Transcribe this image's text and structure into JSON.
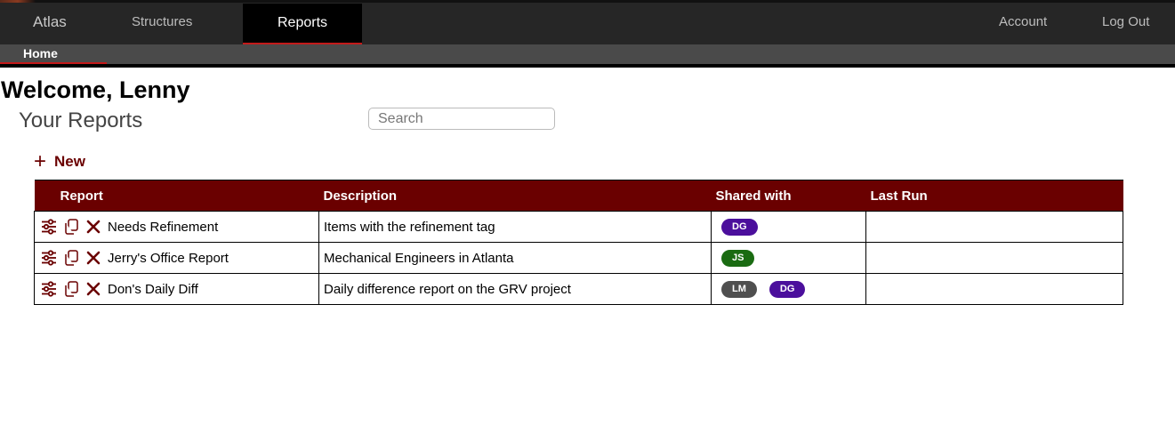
{
  "nav": {
    "brand": "Atlas",
    "structures": "Structures",
    "reports": "Reports",
    "account": "Account",
    "logout": "Log Out"
  },
  "subnav": {
    "home": "Home"
  },
  "page": {
    "welcome": "Welcome, Lenny",
    "section_title": "Your Reports",
    "search_placeholder": "Search",
    "new_label": "New"
  },
  "table": {
    "headers": [
      "Report",
      "Description",
      "Shared with",
      "Last Run"
    ],
    "rows": [
      {
        "name": "Needs Refinement",
        "description": "Items with the refinement tag",
        "shared": [
          {
            "initials": "DG",
            "color": "#4b0f9c"
          }
        ],
        "last_run": ""
      },
      {
        "name": "Jerry's Office Report",
        "description": "Mechanical Engineers in Atlanta",
        "shared": [
          {
            "initials": "JS",
            "color": "#1a6b12"
          }
        ],
        "last_run": ""
      },
      {
        "name": "Don's Daily Diff",
        "description": "Daily difference report on the GRV project",
        "shared": [
          {
            "initials": "LM",
            "color": "#4f4f4f"
          },
          {
            "initials": "DG",
            "color": "#4b0f9c"
          }
        ],
        "last_run": ""
      }
    ]
  },
  "colors": {
    "accent": "#6a0000",
    "nav_bg": "#262626",
    "active_underline": "#c41a1a"
  },
  "icons": {
    "settings": "sliders-icon",
    "copy": "copy-icon",
    "delete": "delete-x-icon",
    "add": "plus-icon"
  }
}
